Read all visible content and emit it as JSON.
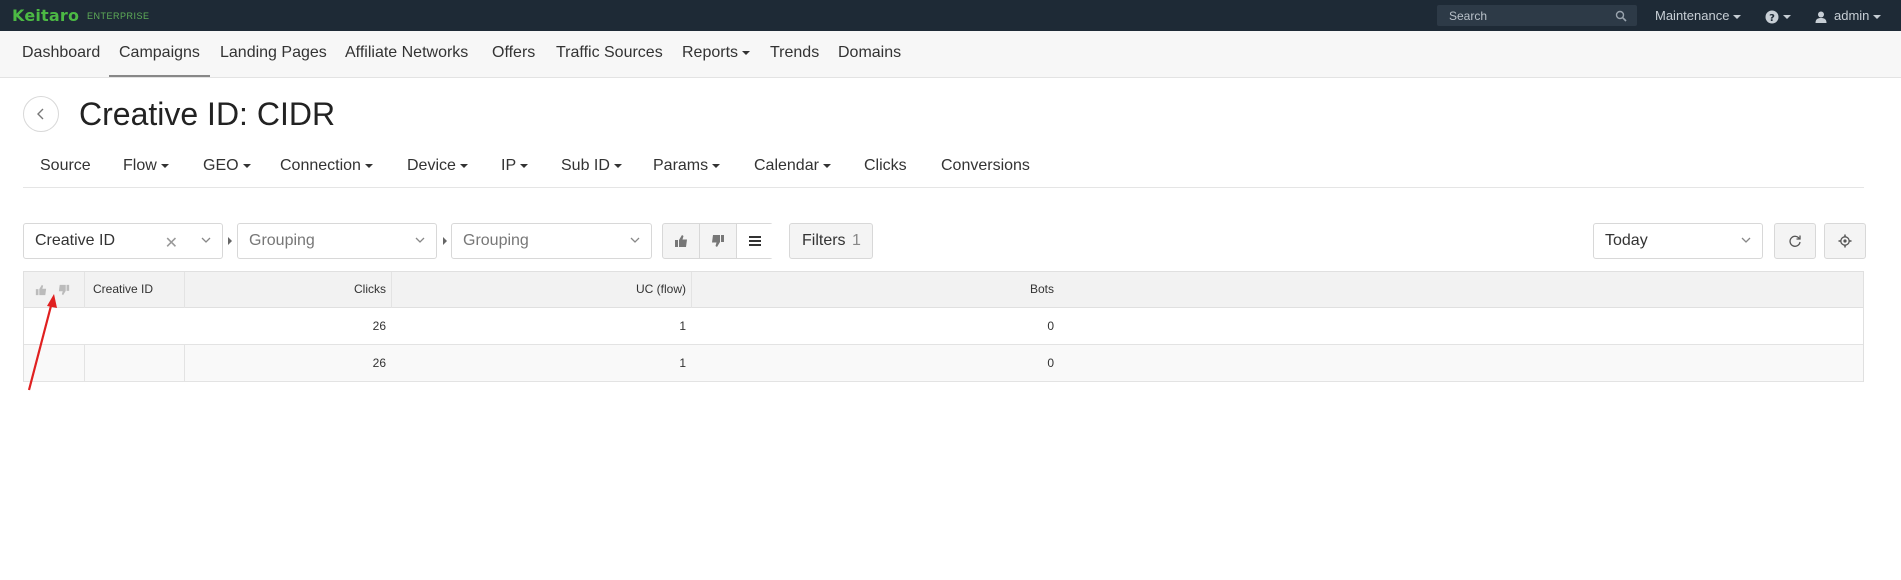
{
  "brand": {
    "name": "Keitaro",
    "edition": "ENTERPRISE"
  },
  "topbar": {
    "search_placeholder": "Search",
    "maintenance": "Maintenance",
    "user": "admin"
  },
  "nav": [
    "Dashboard",
    "Campaigns",
    "Landing Pages",
    "Affiliate Networks",
    "Offers",
    "Traffic Sources",
    "Reports",
    "Trends",
    "Domains"
  ],
  "nav_active": "Campaigns",
  "page_title": "Creative ID: CIDR",
  "subnav": [
    "Source",
    "Flow",
    "GEO",
    "Connection",
    "Device",
    "IP",
    "Sub ID",
    "Params",
    "Calendar",
    "Clicks",
    "Conversions"
  ],
  "toolbar": {
    "grouping_1": "Creative ID",
    "grouping_2_placeholder": "Grouping",
    "grouping_3_placeholder": "Grouping",
    "filters_label": "Filters",
    "filters_count": "1",
    "date_range": "Today"
  },
  "table": {
    "columns": [
      "Creative ID",
      "Clicks",
      "UC (flow)",
      "Bots"
    ],
    "rows": [
      {
        "creative_id": "",
        "clicks": "26",
        "uc_flow": "1",
        "bots": "0"
      }
    ],
    "totals": {
      "creative_id": "",
      "clicks": "26",
      "uc_flow": "1",
      "bots": "0"
    }
  },
  "colors": {
    "topbar_bg": "#1e2a36",
    "brand_green": "#4cb944",
    "annotation_arrow": "#e02020"
  }
}
